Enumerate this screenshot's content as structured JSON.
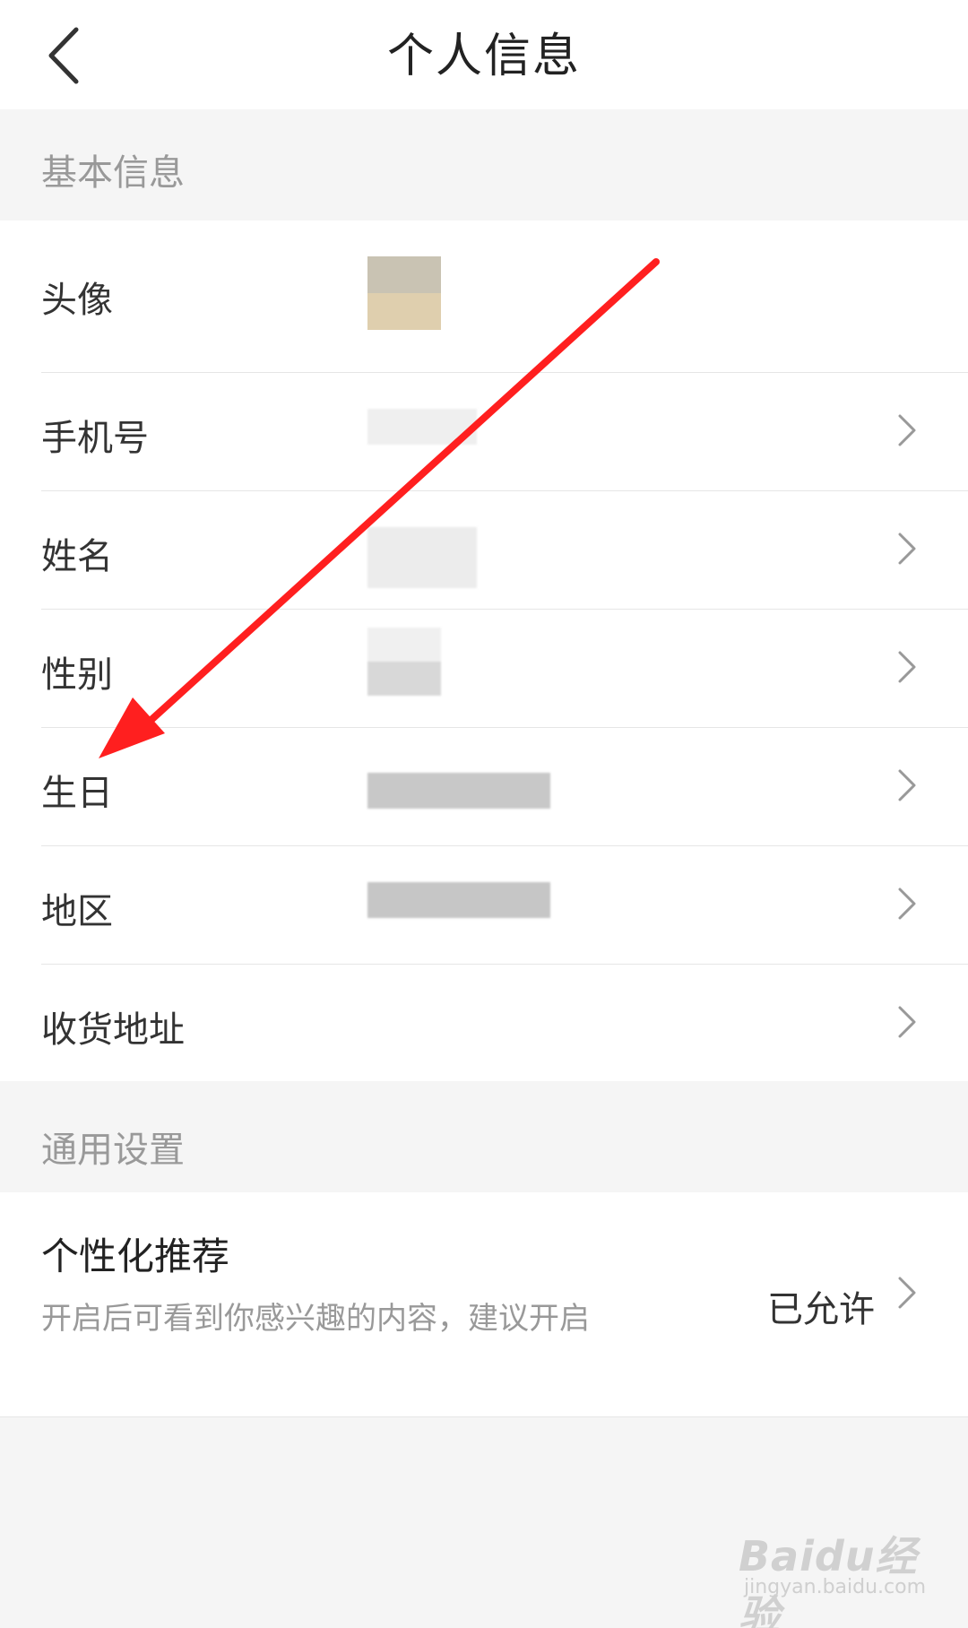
{
  "header": {
    "title": "个人信息",
    "back_icon": "chevron-left-icon"
  },
  "sections": {
    "basic": "基本信息",
    "general": "通用设置"
  },
  "basic_rows": {
    "avatar": "头像",
    "phone": "手机号",
    "name": "姓名",
    "gender": "性别",
    "birthday": "生日",
    "region": "地区",
    "address": "收货地址"
  },
  "recommend": {
    "title": "个性化推荐",
    "description": "开启后可看到你感兴趣的内容，建议开启",
    "status": "已允许"
  },
  "annotation": {
    "color": "#ff1f1f"
  },
  "watermark": {
    "logo": "Baidu经验",
    "site": "jingyan.baidu.com"
  },
  "colors": {
    "background": "#f5f5f5",
    "card": "#ffffff",
    "text": "#333333",
    "muted": "#999999"
  }
}
